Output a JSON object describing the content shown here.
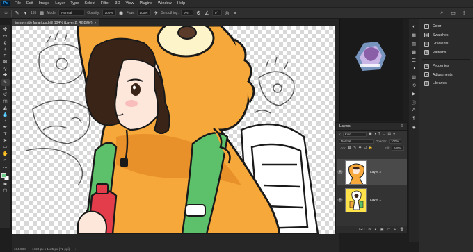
{
  "app": {
    "logo": "Ps"
  },
  "menu": [
    "File",
    "Edit",
    "Image",
    "Layer",
    "Type",
    "Select",
    "Filter",
    "3D",
    "View",
    "Plugins",
    "Window",
    "Help"
  ],
  "options": {
    "brush_size": "135",
    "mode_label": "Mode:",
    "mode_value": "Normal",
    "opacity_label": "Opacity:",
    "opacity_value": "100%",
    "flow_label": "Flow:",
    "flow_value": "100%",
    "smoothing_label": "Smoothing:",
    "smoothing_value": "0%",
    "angle_value": "0°"
  },
  "document": {
    "tab_title": "jimmy mide fanart.psd @ 104% (Layer 2, RGB/8#)",
    "close": "×"
  },
  "status": {
    "zoom": "104.03%",
    "info": "1728 px x 1125 px (72 ppi)",
    "arrow": "›"
  },
  "colors": {
    "foreground": "#6fd08a",
    "background": "#ffffff",
    "accent": "#31a8ff"
  },
  "right_panels": [
    {
      "label": "Color",
      "icon": "color-icon"
    },
    {
      "label": "Swatches",
      "icon": "swatches-icon"
    },
    {
      "label": "Gradients",
      "icon": "gradients-icon"
    },
    {
      "label": "Patterns",
      "icon": "patterns-icon"
    },
    {
      "label": "Properties",
      "icon": "properties-icon"
    },
    {
      "label": "Adjustments",
      "icon": "adjustments-icon"
    },
    {
      "label": "Libraries",
      "icon": "libraries-icon"
    }
  ],
  "layers_panel": {
    "title": "Layers",
    "menu": "≡",
    "kind_label": "Kind",
    "blend_mode": "Normal",
    "opacity_label": "Opacity:",
    "opacity_value": "100%",
    "lock_label": "Lock:",
    "fill_label": "Fill:",
    "fill_value": "100%",
    "layers": [
      {
        "name": "Layer 2",
        "visible": true,
        "selected": true
      },
      {
        "name": "Layer 1",
        "visible": true,
        "selected": false
      }
    ],
    "footer": [
      "GO",
      "fx",
      "◐",
      "▣",
      "▭",
      "+",
      "🗑"
    ]
  }
}
